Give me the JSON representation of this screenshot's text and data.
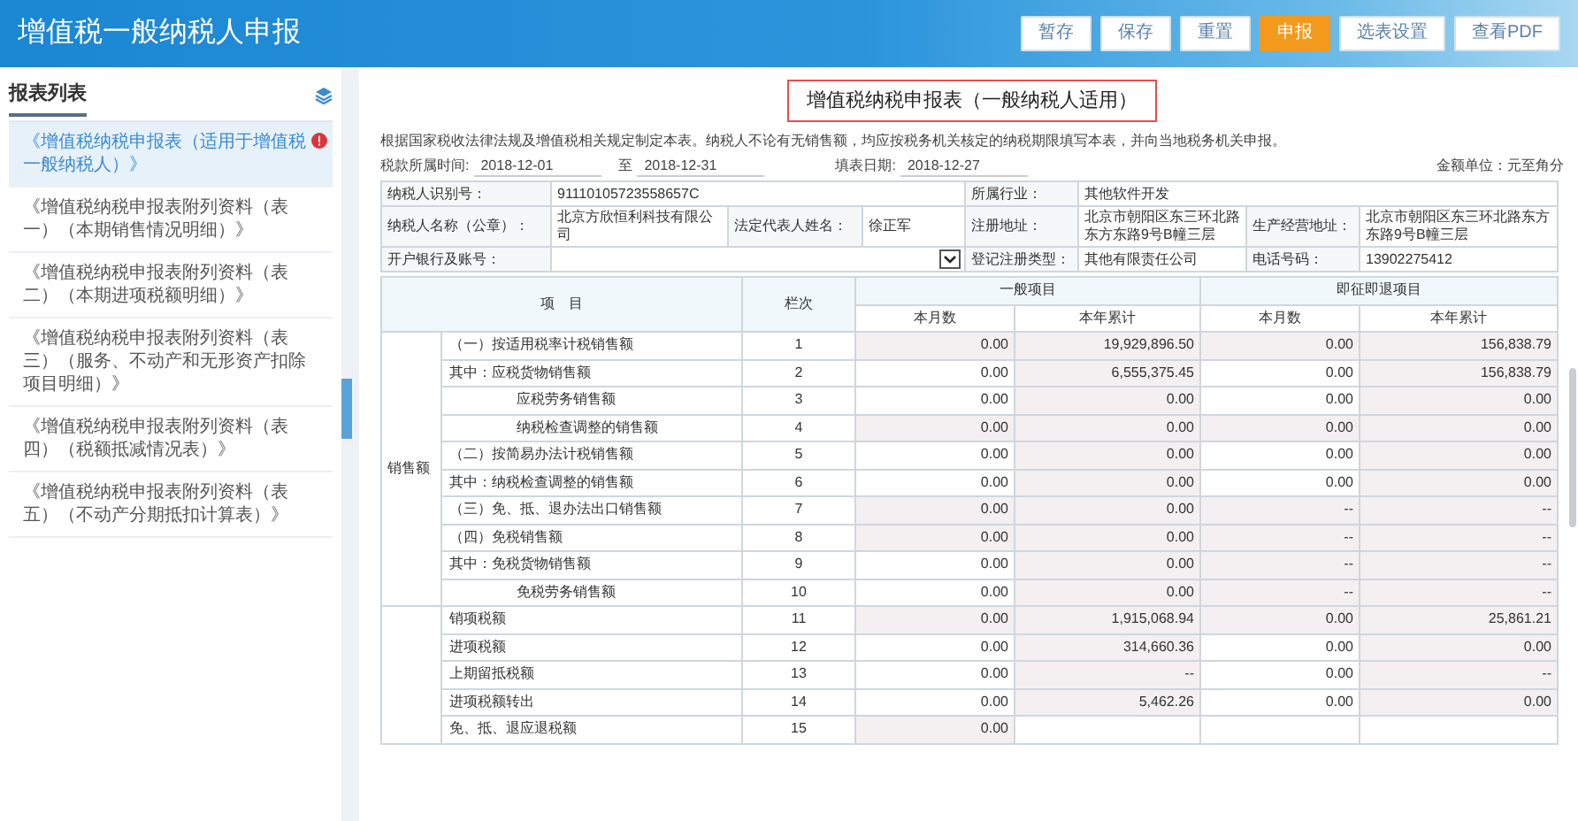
{
  "window": {
    "title": "增值税一般纳税人申报"
  },
  "toolbar": [
    {
      "label": "暂存",
      "selected": false
    },
    {
      "label": "保存",
      "selected": false
    },
    {
      "label": "重置",
      "selected": false
    },
    {
      "label": "申报",
      "selected": true
    },
    {
      "label": "选表设置",
      "selected": false
    },
    {
      "label": "查看PDF",
      "selected": false
    }
  ],
  "sidebar": {
    "title": "报表列表",
    "items": [
      {
        "label": "《增值税纳税申报表（适用于增值税一般纳税人）》",
        "selected": true,
        "alert": true
      },
      {
        "label": "《增值税纳税申报表附列资料（表一）（本期销售情况明细）》",
        "selected": false,
        "alert": false
      },
      {
        "label": "《增值税纳税申报表附列资料（表二）（本期进项税额明细）》",
        "selected": false,
        "alert": false
      },
      {
        "label": "《增值税纳税申报表附列资料（表三）（服务、不动产和无形资产扣除项目明细）》",
        "selected": false,
        "alert": false
      },
      {
        "label": "《增值税纳税申报表附列资料（表四）（税额抵减情况表）》",
        "selected": false,
        "alert": false
      },
      {
        "label": "《增值税纳税申报表附列资料（表五）（不动产分期抵扣计算表）》",
        "selected": false,
        "alert": false
      }
    ]
  },
  "form": {
    "title": "增值税纳税申报表（一般纳税人适用）",
    "notice": "根据国家税收法律法规及增值税相关规定制定本表。纳税人不论有无销售额，均应按税务机关核定的纳税期限填写本表，并向当地税务机关申报。",
    "period_label": "税款所属时间:",
    "period_from": "2018-12-01",
    "period_to_label": "至",
    "period_to": "2018-12-31",
    "fill_date_label": "填表日期:",
    "fill_date": "2018-12-27",
    "unit": "金额单位：元至角分",
    "info": {
      "taxpayer_id_label": "纳税人识别号：",
      "taxpayer_id": "91110105723558657C",
      "industry_label": "所属行业：",
      "industry": "其他软件开发",
      "name_label": "纳税人名称（公章）：",
      "name": "北京方欣恒利科技有限公司",
      "legal_rep_label": "法定代表人姓名：",
      "legal_rep": "徐正军",
      "reg_address_label": "注册地址：",
      "reg_address": "北京市朝阳区东三环北路东方东路9号B幢三层",
      "biz_address_label": "生产经营地址：",
      "biz_address": "北京市朝阳区东三环北路东方东路9号B幢三层",
      "bank_label": "开户银行及账号：",
      "reg_type_label": "登记注册类型：",
      "reg_type": "其他有限责任公司",
      "phone_label": "电话号码：",
      "phone": "13902275412"
    }
  },
  "table": {
    "item_header": "项　目",
    "line_header": "栏次",
    "groups": [
      "一般项目",
      "即征即退项目"
    ],
    "subcolumns": [
      "本月数",
      "本年累计",
      "本月数",
      "本年累计"
    ],
    "sections": [
      {
        "label": "销售额",
        "rows": [
          {
            "item": "（一）按适用税率计税销售额",
            "indent": false,
            "line": "1",
            "values": [
              "0.00",
              "19,929,896.50",
              "0.00",
              "156,838.79"
            ],
            "readonly": [
              true,
              true,
              true,
              true
            ]
          },
          {
            "item": "其中：应税货物销售额",
            "indent": false,
            "line": "2",
            "values": [
              "0.00",
              "6,555,375.45",
              "0.00",
              "156,838.79"
            ],
            "readonly": [
              false,
              true,
              false,
              true
            ]
          },
          {
            "item": "应税劳务销售额",
            "indent": true,
            "line": "3",
            "values": [
              "0.00",
              "0.00",
              "0.00",
              "0.00"
            ],
            "readonly": [
              false,
              true,
              false,
              true
            ]
          },
          {
            "item": "纳税检查调整的销售额",
            "indent": true,
            "line": "4",
            "values": [
              "0.00",
              "0.00",
              "0.00",
              "0.00"
            ],
            "readonly": [
              true,
              true,
              true,
              true
            ]
          },
          {
            "item": "（二）按简易办法计税销售额",
            "indent": false,
            "line": "5",
            "values": [
              "0.00",
              "0.00",
              "0.00",
              "0.00"
            ],
            "readonly": [
              false,
              true,
              false,
              true
            ]
          },
          {
            "item": "其中：纳税检查调整的销售额",
            "indent": false,
            "line": "6",
            "values": [
              "0.00",
              "0.00",
              "0.00",
              "0.00"
            ],
            "readonly": [
              false,
              true,
              false,
              true
            ]
          },
          {
            "item": "（三）免、抵、退办法出口销售额",
            "indent": false,
            "line": "7",
            "values": [
              "0.00",
              "0.00",
              "--",
              "--"
            ],
            "readonly": [
              true,
              true,
              true,
              true
            ]
          },
          {
            "item": "（四）免税销售额",
            "indent": false,
            "line": "8",
            "values": [
              "0.00",
              "0.00",
              "--",
              "--"
            ],
            "readonly": [
              true,
              true,
              true,
              true
            ]
          },
          {
            "item": "其中：免税货物销售额",
            "indent": false,
            "line": "9",
            "values": [
              "0.00",
              "0.00",
              "--",
              "--"
            ],
            "readonly": [
              false,
              true,
              true,
              true
            ]
          },
          {
            "item": "免税劳务销售额",
            "indent": true,
            "line": "10",
            "values": [
              "0.00",
              "0.00",
              "--",
              "--"
            ],
            "readonly": [
              false,
              true,
              true,
              true
            ]
          }
        ]
      },
      {
        "rows": [
          {
            "item": "销项税额",
            "indent": false,
            "line": "11",
            "values": [
              "0.00",
              "1,915,068.94",
              "0.00",
              "25,861.21"
            ],
            "readonly": [
              true,
              true,
              true,
              true
            ]
          },
          {
            "item": "进项税额",
            "indent": false,
            "line": "12",
            "values": [
              "0.00",
              "314,660.36",
              "0.00",
              "0.00"
            ],
            "readonly": [
              false,
              true,
              false,
              true
            ]
          },
          {
            "item": "上期留抵税额",
            "indent": false,
            "line": "13",
            "values": [
              "0.00",
              "--",
              "0.00",
              "--"
            ],
            "readonly": [
              false,
              true,
              false,
              true
            ]
          },
          {
            "item": "进项税额转出",
            "indent": false,
            "line": "14",
            "values": [
              "0.00",
              "5,462.26",
              "0.00",
              "0.00"
            ],
            "readonly": [
              false,
              true,
              false,
              true
            ]
          },
          {
            "item": "免、抵、退应退税额",
            "indent": false,
            "line": "15",
            "values": [
              "0.00"
            ],
            "readonly": [
              true
            ]
          }
        ]
      }
    ]
  }
}
